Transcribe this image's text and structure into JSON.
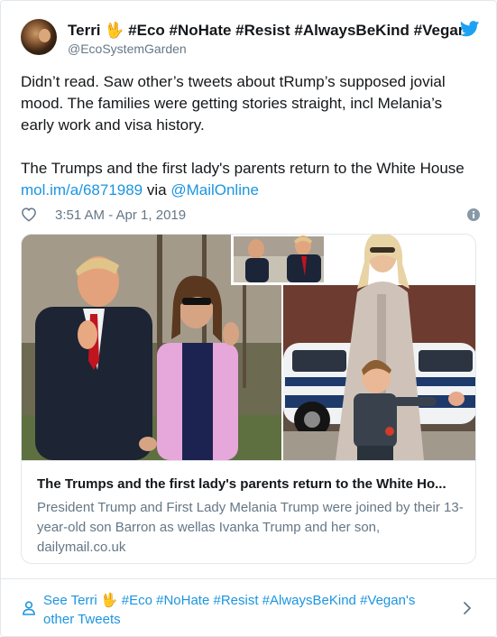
{
  "author": {
    "display_name": "Terri 🖖 #Eco #NoHate #Resist #AlwaysBeKind #Vegan's",
    "screen_name": "@EcoSystemGarden"
  },
  "tweet": {
    "text_line1": "Didn’t read. Saw other’s tweets about tRump’s supposed jovial mood. The families were getting stories straight, incl Melania’s early work and visa history.",
    "text_line2_prefix": "The Trumps and the first lady's parents return to the White House ",
    "link_url": "mol.im/a/6871989",
    "via_text": " via ",
    "via_handle": "@MailOnline",
    "timestamp": "3:51 AM - Apr 1, 2019"
  },
  "card": {
    "title": "The Trumps and the first lady's parents return to the White Ho...",
    "description": "President Trump and First Lady Melania Trump were joined by their 13-year-old son Barron as wellas Ivanka Trump and her son,",
    "domain": "dailymail.co.uk"
  },
  "footer": {
    "link_text": "See Terri 🖖 #Eco #NoHate #Resist #AlwaysBeKind #Vegan's other Tweets"
  },
  "colors": {
    "link": "#1b95e0",
    "muted": "#657786",
    "text": "#14171a",
    "border": "#e1e8ed"
  }
}
